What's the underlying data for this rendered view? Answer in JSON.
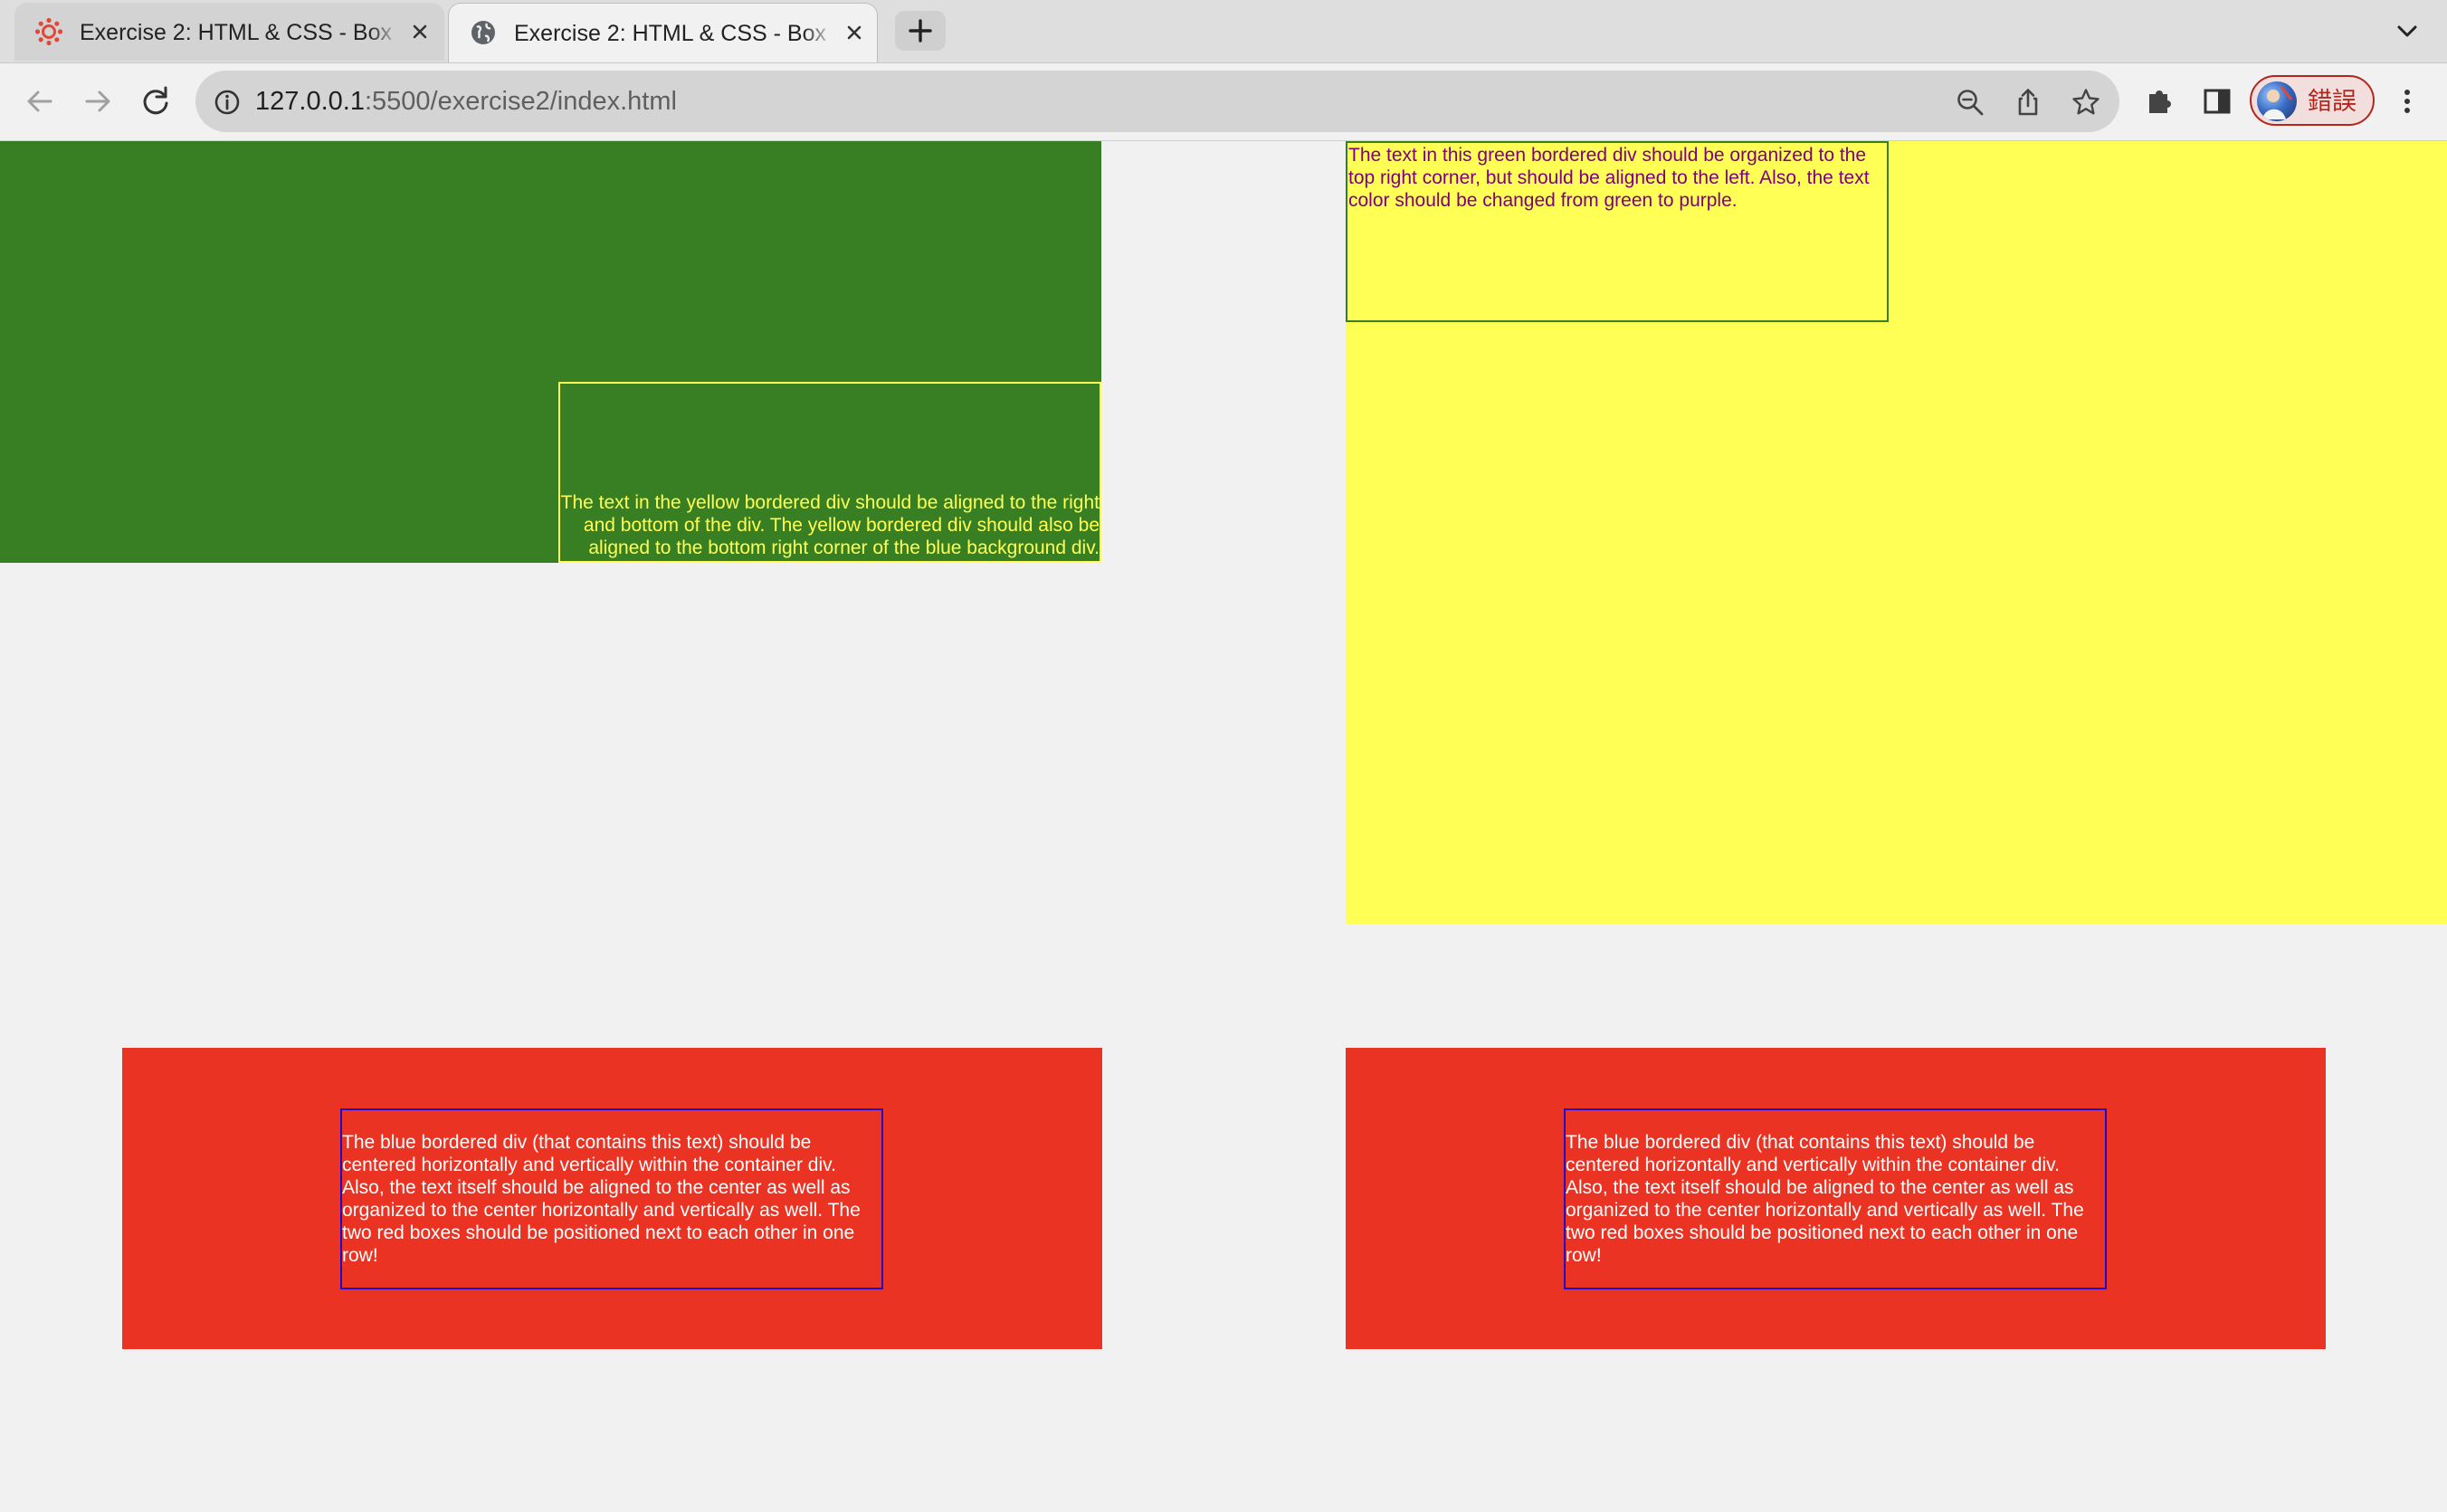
{
  "browser": {
    "tabs": [
      {
        "title": "Exercise 2: HTML & CSS - Box Model",
        "icon": "canvas-lms-icon",
        "active": false
      },
      {
        "title": "Exercise 2: HTML & CSS - Box Model",
        "icon": "globe-icon",
        "active": true
      }
    ],
    "address": {
      "host": "127.0.0.1",
      "rest": ":5500/exercise2/index.html"
    },
    "profile_label": "錯誤",
    "colors": {
      "profile_accent": "#b3261e"
    }
  },
  "page": {
    "colors": {
      "green": "#387f23",
      "yellow": "#ffff55",
      "purple": "#800080",
      "red": "#ea3323",
      "blue": "#2200cc",
      "background": "#f1f1f1"
    },
    "yellow_bordered_text": "The text in the yellow bordered div should be aligned to the right and bottom of the div. The yellow bordered div should also be aligned to the bottom right corner of the blue background div.",
    "green_bordered_text": "The text in this green bordered div should be organized to the top right corner, but should be aligned to the left. Also, the text color should be changed from green to purple.",
    "red_boxes": [
      {
        "text": "The blue bordered div (that contains this text) should be centered horizontally and vertically within the container div. Also, the text itself should be aligned to the center as well as organized to the center horizontally and vertically as well. The two red boxes should be positioned next to each other in one row!"
      },
      {
        "text": "The blue bordered div (that contains this text) should be centered horizontally and vertically within the container div. Also, the text itself should be aligned to the center as well as organized to the center horizontally and vertically as well. The two red boxes should be positioned next to each other in one row!"
      }
    ]
  }
}
